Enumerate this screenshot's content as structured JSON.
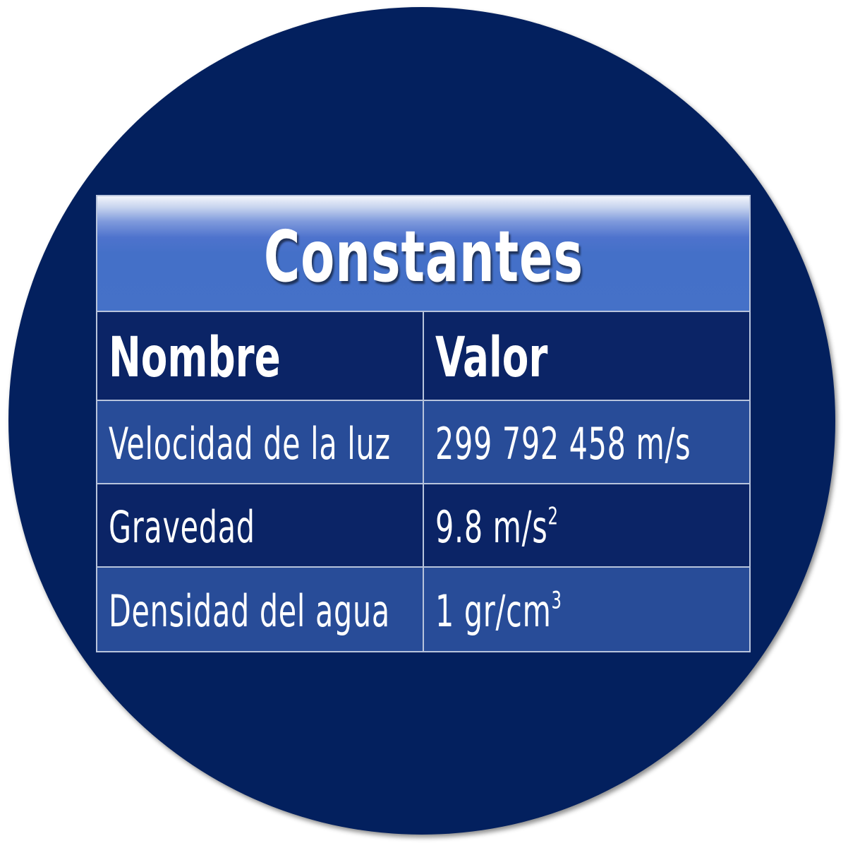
{
  "table": {
    "title": "Constantes",
    "headers": {
      "name": "Nombre",
      "value": "Valor"
    },
    "rows": [
      {
        "name": "Velocidad de la luz",
        "value": "299 792 458 m/s",
        "exponent": ""
      },
      {
        "name": "Gravedad",
        "value": "9.8 m/s",
        "exponent": "2"
      },
      {
        "name": "Densidad del agua",
        "value": "1 gr/cm",
        "exponent": "3"
      }
    ]
  },
  "colors": {
    "circle": "#03205e",
    "title_band": "#4571c8",
    "row_dark": "#0b2466",
    "row_light": "#284c98",
    "border": "#b8c4dc",
    "text": "#ffffff"
  }
}
